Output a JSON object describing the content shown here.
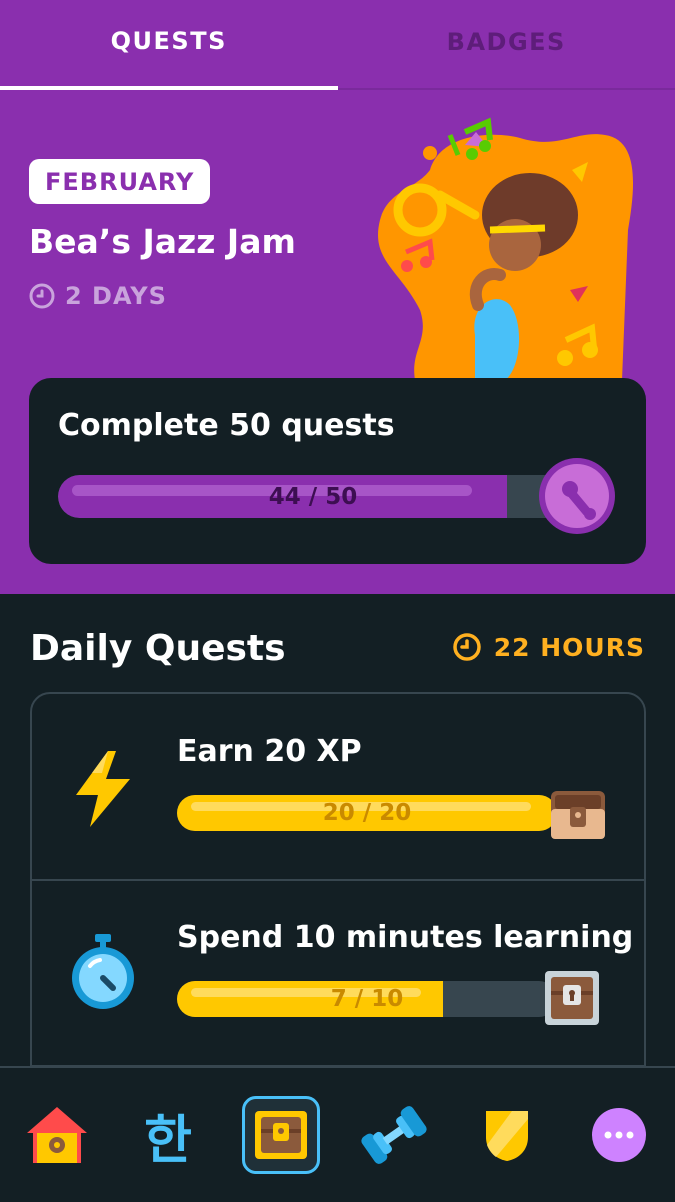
{
  "tabs": [
    {
      "label": "QUESTS",
      "active": true
    },
    {
      "label": "BADGES",
      "active": false
    }
  ],
  "monthly": {
    "month": "FEBRUARY",
    "title": "Bea’s Jazz Jam",
    "time_left": "2 DAYS",
    "quest_label": "Complete 50 quests",
    "progress_text": "44 / 50",
    "progress_value": 44,
    "progress_max": 50
  },
  "daily": {
    "title": "Daily Quests",
    "time_left": "22 HOURS",
    "quests": [
      {
        "label": "Earn 20 XP",
        "progress_text": "20 / 20",
        "value": 20,
        "max": 20,
        "icon": "lightning-icon",
        "reward": "chest-open-icon"
      },
      {
        "label": "Spend 10 minutes learning",
        "progress_text": "7 / 10",
        "value": 7,
        "max": 10,
        "icon": "stopwatch-icon",
        "reward": "chest-locked-icon"
      }
    ]
  },
  "nav": {
    "items": [
      "home-icon",
      "language-icon",
      "quests-chest-icon",
      "practice-dumbbell-icon",
      "league-shield-icon",
      "more-icon"
    ],
    "language_glyph": "한",
    "selected": "quests-chest-icon"
  },
  "colors": {
    "purple": "#8a2fae",
    "dark": "#131f24",
    "gold": "#ffc800",
    "blue": "#49c0f8"
  }
}
